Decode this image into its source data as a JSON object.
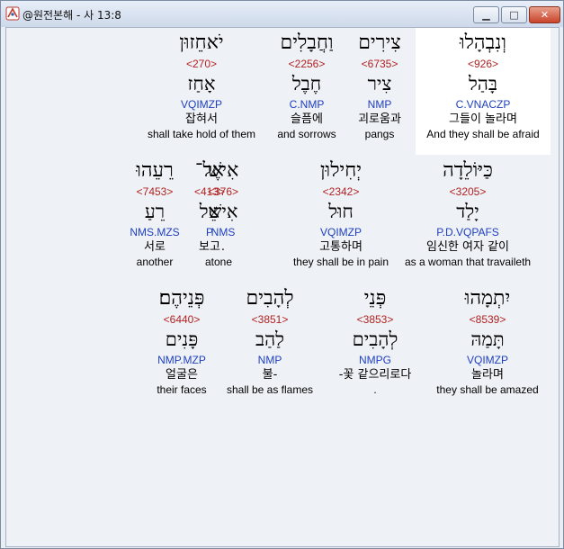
{
  "window": {
    "title": "@원전본해 - 사 13:8"
  },
  "rows": [
    [
      {
        "heb": "וְנִבְהָלוּ",
        "strong": "<926>",
        "lemma": "בָּהַל",
        "morph": "C.VNACZP",
        "kor": "그들이 놀라며",
        "eng": "And they shall be afraid"
      },
      {
        "heb": "צִירִים",
        "strong": "<6735>",
        "lemma": "צִיר",
        "morph": "NMP",
        "kor": "괴로움과",
        "eng": "pangs"
      },
      {
        "heb": "וַחֲבָלִים",
        "strong": "<2256>",
        "lemma": "חֶבֶל",
        "morph": "C.NMP",
        "kor": "슬픔에",
        "eng": "and sorrows"
      },
      {
        "heb": "יֹאחֵזוּן",
        "strong": "<270>",
        "lemma": "אָחַז",
        "morph": "VQIMZP",
        "kor": "잡혀서",
        "eng": "shall take hold of them"
      }
    ],
    [
      {
        "heb": "כַּיּוֹלֵדָה",
        "strong": "<3205>",
        "lemma": "יָלַד",
        "morph": "P.D.VQPAFS",
        "kor": "임신한 여자 같이",
        "eng": "as a woman that travaileth"
      },
      {
        "heb": "יְחִילוּן",
        "strong": "<2342>",
        "lemma": "חוּל",
        "morph": "VQIMZP",
        "kor": "고통하며",
        "eng": "they shall be in pain"
      },
      {
        "heb": "אִישׁ",
        "strong": "<376>",
        "lemma": "אִישׁ",
        "morph": "NMS",
        "kor": ".",
        "eng": "one"
      },
      {
        "heb": "אֶל־",
        "strong": "<413>",
        "lemma": "אֵל",
        "morph": "P",
        "kor": "보고",
        "eng": "at"
      },
      {
        "heb": "רֵעֵהוּ",
        "strong": "<7453>",
        "lemma": "רֵעַ",
        "morph": "NMS.MZS",
        "kor": "서로",
        "eng": "another"
      }
    ],
    [
      {
        "heb": "יִתְמָהוּ",
        "strong": "<8539>",
        "lemma": "תָּמַהּ",
        "morph": "VQIMZP",
        "kor": "놀라며",
        "eng": "they shall be amazed"
      },
      {
        "heb": "פְּנֵי",
        "strong": "<3853>",
        "lemma": "לְהָבִים",
        "morph": "NMPG",
        "kor": "-꽃 같으리로다",
        "eng": "."
      },
      {
        "heb": "לְהָבִים",
        "strong": "<3851>",
        "lemma": "לַהַב",
        "morph": "NMP",
        "kor": "불-",
        "eng": "shall be as flames"
      },
      {
        "heb": "פְּנֵיהֶם׃",
        "strong": "<6440>",
        "lemma": "פָּנִים",
        "morph": "NMP.MZP",
        "kor": "얼굴은",
        "eng": "their faces"
      }
    ]
  ],
  "colors": {
    "strong": "#b22222",
    "morph": "#1f3fbf",
    "highlight": "#ffffff"
  },
  "icons": {
    "app": "app-logo-icon",
    "minimize": "minimize-icon",
    "maximize": "maximize-icon",
    "close": "close-icon"
  }
}
